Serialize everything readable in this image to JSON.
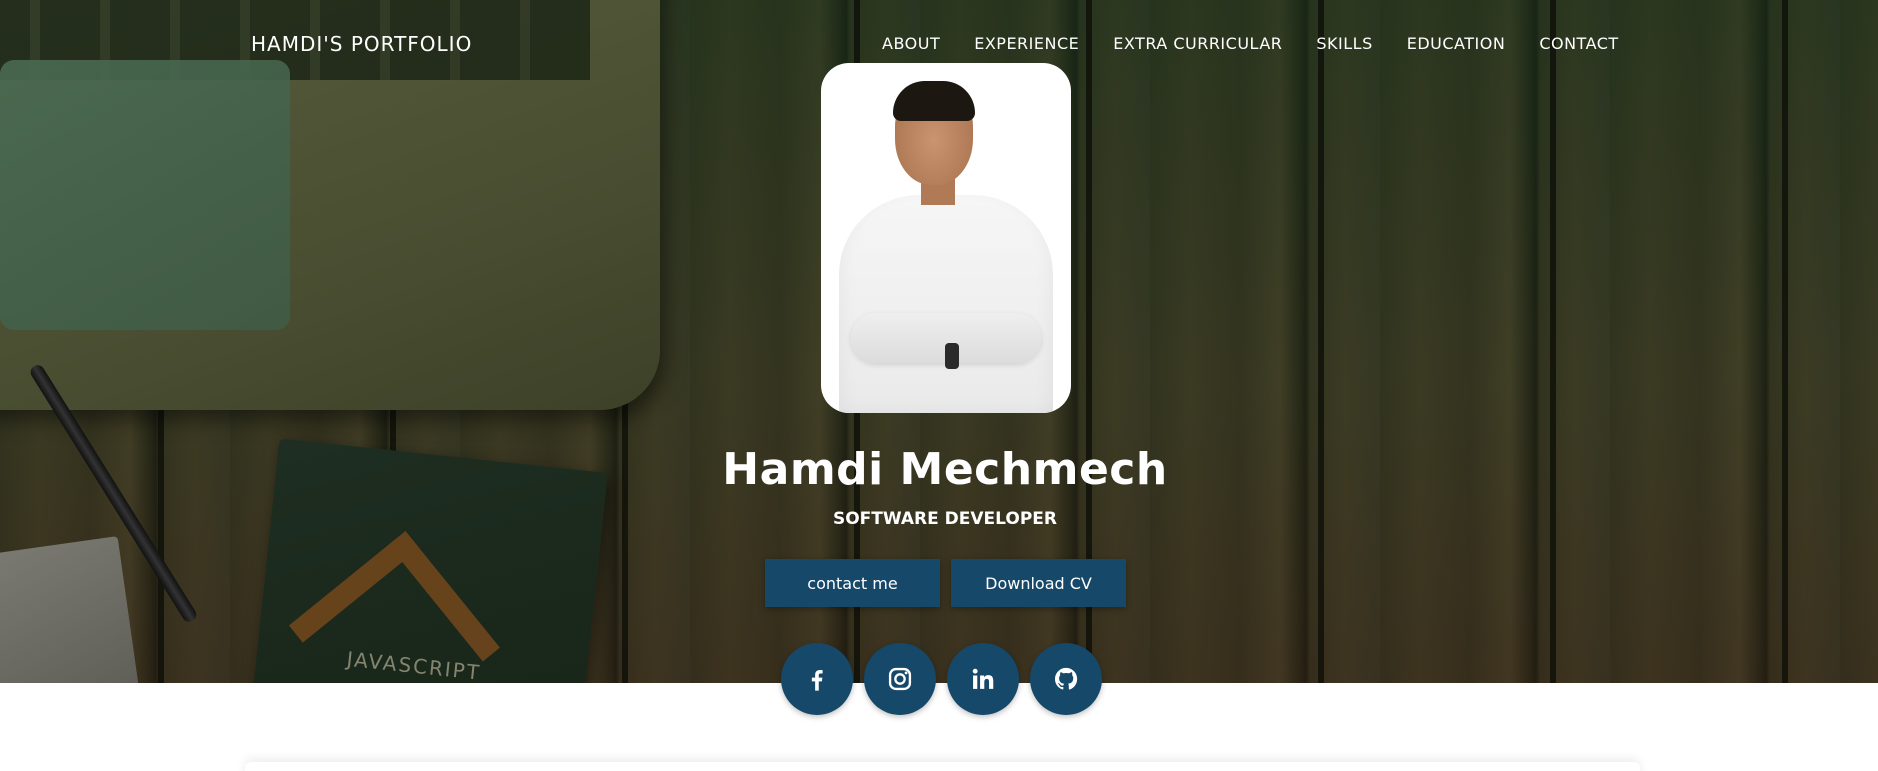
{
  "brand": "HAMDI'S PORTFOLIO",
  "nav": {
    "items": [
      "ABOUT",
      "EXPERIENCE",
      "EXTRA CURRICULAR",
      "SKILLS",
      "EDUCATION",
      "CONTACT"
    ]
  },
  "hero": {
    "name": "Hamdi Mechmech",
    "role": "SOFTWARE DEVELOPER",
    "book_text": "JAVASCRIPT"
  },
  "buttons": {
    "contact": "contact me",
    "cv": "Download CV"
  },
  "social": [
    {
      "icon": "facebook-icon"
    },
    {
      "icon": "instagram-icon"
    },
    {
      "icon": "linkedin-icon"
    },
    {
      "icon": "github-icon"
    }
  ],
  "colors": {
    "accent": "#16486a",
    "text_on_hero": "#ffffff"
  }
}
